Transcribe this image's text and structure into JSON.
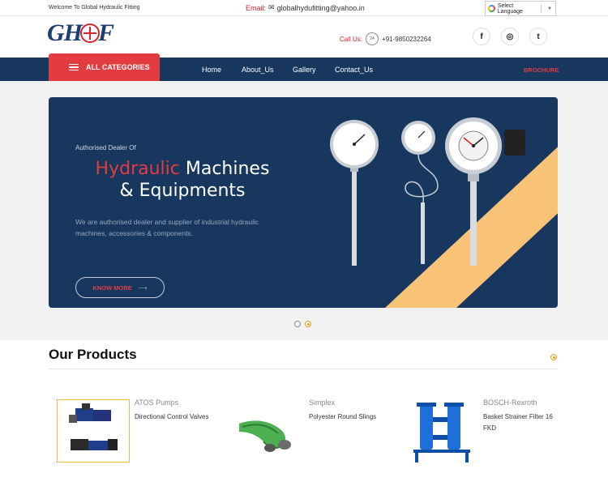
{
  "topbar": {
    "welcome": "Welcome To Global Hydraulic Fitting",
    "email_label": "Email:",
    "email": "globalhydufitting@yahoo.in",
    "language": "Select Language"
  },
  "header": {
    "logo": "GHF",
    "call_label": "Call Us:",
    "phone_icon_text": "24",
    "phone": "+91-9850232264",
    "social": [
      "f",
      "◎",
      "t"
    ]
  },
  "nav": {
    "all_categories": "ALL CATEGORIES",
    "links": [
      "Home",
      "About_Us",
      "Gallery",
      "Contact_Us"
    ],
    "brochure": "BROCHURE"
  },
  "hero": {
    "eyebrow": "Authorised Dealer Of",
    "title_red": "Hydraulic",
    "title_rest": " Machines",
    "title_line2": "& Equipments",
    "description": "We are authorised dealer and supplier of industrial hydraulic machines, accessories & components.",
    "cta": "KNOW MORE",
    "cta_arrow": "⟶",
    "colors": {
      "banner": "#17375f",
      "accent": "#e53b40",
      "stripe": "#f8c277"
    }
  },
  "products": {
    "title": "Our Products",
    "items": [
      {
        "name": "ATOS Pumps",
        "desc": "Directional Control Valves"
      },
      {
        "name": "Simplex",
        "desc": "Polyester Round Slings"
      },
      {
        "name": "BOSCH-Rexroth",
        "desc": "Basket Strainer Filter 16 FKD"
      }
    ]
  }
}
